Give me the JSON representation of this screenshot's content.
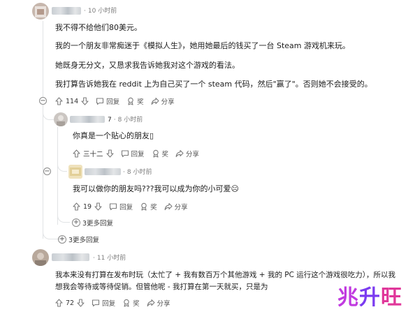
{
  "comments": {
    "c1": {
      "time": "10 小时前",
      "paragraphs": [
        "我不得不给他们80美元。",
        "我的一个朋友非常痴迷于《模拟人生》，她用她最后的钱买了一台 Steam 游戏机来玩。",
        "她既身无分文，又恳求我告诉她我对这个游戏的看法。",
        "我打算告诉她我在 reddit 上为自己买了一个 steam 代码，然后\"赢了\"。否则她不会接受的。"
      ],
      "votes": "114",
      "reply": "回复",
      "award": "奖",
      "share": "分享"
    },
    "c2": {
      "name_tail": "7",
      "time": "8 小时前",
      "text": "你真是一个贴心的朋友▯",
      "votes": "三十二",
      "reply": "回复",
      "award": "奖",
      "share": "分享"
    },
    "c3": {
      "time": "8 小时前",
      "text": "我可以做你的朋友吗???我可以成为你的小可爱☹",
      "votes": "19",
      "reply": "回复",
      "award": "奖",
      "share": "分享"
    },
    "more_inner": "3更多回复",
    "more_outer": "3更多回复",
    "c4": {
      "time": "11 小时前",
      "line1": "我本来没有打算在发布时玩（太忙了 + 我有数百万个其他游戏 + 我的 PC 运行这个游戏很吃力），所以我",
      "line2": "想我会等待或等待促销。但管他呢 - 我打算在第一天就买，只是为",
      "votes": "72",
      "reply": "回复",
      "award": "奖",
      "share": "分享"
    }
  },
  "watermark": {
    "part1": "兆",
    "part2": "升",
    "part3": "旺"
  },
  "colors": {
    "upvote_gray": "#7c7c7c",
    "thread_line": "#e1e3e5",
    "text": "#1c1c1c"
  }
}
